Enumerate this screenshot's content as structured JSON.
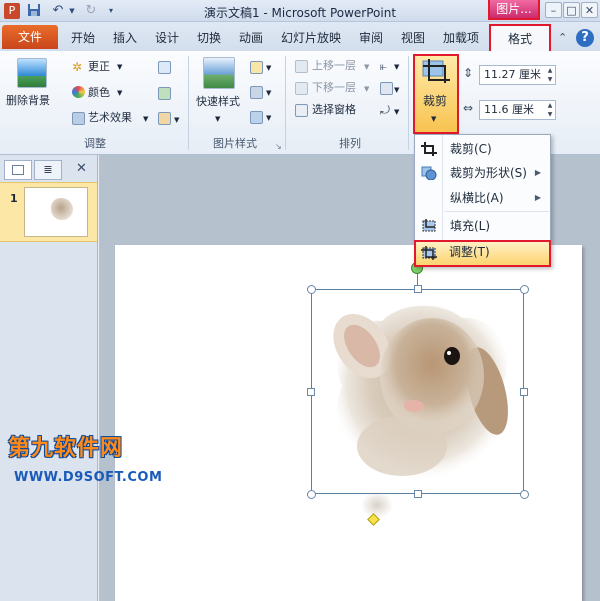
{
  "window": {
    "title": "演示文稿1 - Microsoft PowerPoint",
    "context_tab_label": "图片...",
    "quick_access": [
      "save-icon",
      "undo-icon",
      "redo-icon",
      "customize-icon"
    ],
    "controls": [
      "minimize-icon",
      "restore-icon",
      "close-icon"
    ]
  },
  "tabs": {
    "file": "文件",
    "items": [
      "开始",
      "插入",
      "设计",
      "切换",
      "动画",
      "幻灯片放映",
      "审阅",
      "视图",
      "加载项"
    ],
    "format": "格式",
    "extra_icons": [
      "ribbon-collapse-icon",
      "help-icon"
    ]
  },
  "ribbon": {
    "adjust": {
      "remove_bg": "删除背景",
      "corrections": "更正",
      "color": "颜色",
      "artistic": "艺术效果",
      "title": "调整"
    },
    "styles": {
      "quick_styles": "快速样式",
      "title": "图片样式"
    },
    "arrange": {
      "bring_forward": "上移一层",
      "send_backward": "下移一层",
      "selection_pane": "选择窗格",
      "title": "排列"
    },
    "size": {
      "crop": "裁剪",
      "height": "11.27 厘米",
      "width": "11.6 厘米"
    }
  },
  "crop_menu": {
    "items": [
      {
        "label": "裁剪(C)",
        "icon": "crop-icon"
      },
      {
        "label": "裁剪为形状(S)",
        "icon": "crop-to-shape-icon",
        "submenu": true
      },
      {
        "label": "纵横比(A)",
        "submenu": true
      },
      {
        "label": "填充(L)",
        "icon": "fill-icon"
      },
      {
        "label": "调整(T)",
        "icon": "fit-icon",
        "highlighted": true
      }
    ]
  },
  "slides_panel": {
    "slide_number": "1"
  },
  "watermark": {
    "line1": "第九软件网",
    "line2": "WWW.D9SOFT.COM"
  },
  "colors": {
    "file_tab": "#d2521f",
    "highlight_border": "#e2192c",
    "menu_highlight": "#fcd36f"
  }
}
